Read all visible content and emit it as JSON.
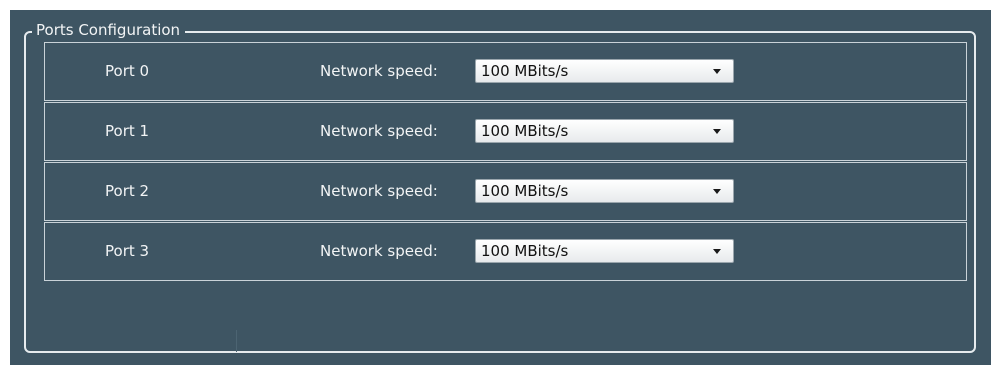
{
  "group": {
    "title": "Ports Configuration"
  },
  "ports": [
    {
      "name": "Port 0",
      "speed_label": "Network speed:",
      "speed_value": "100 MBits/s"
    },
    {
      "name": "Port 1",
      "speed_label": "Network speed:",
      "speed_value": "100 MBits/s"
    },
    {
      "name": "Port 2",
      "speed_label": "Network speed:",
      "speed_value": "100 MBits/s"
    },
    {
      "name": "Port 3",
      "speed_label": "Network speed:",
      "speed_value": "100 MBits/s"
    }
  ],
  "colors": {
    "panel_background": "#3e5563",
    "border": "#e6ebee",
    "text": "#f2f4f5"
  }
}
